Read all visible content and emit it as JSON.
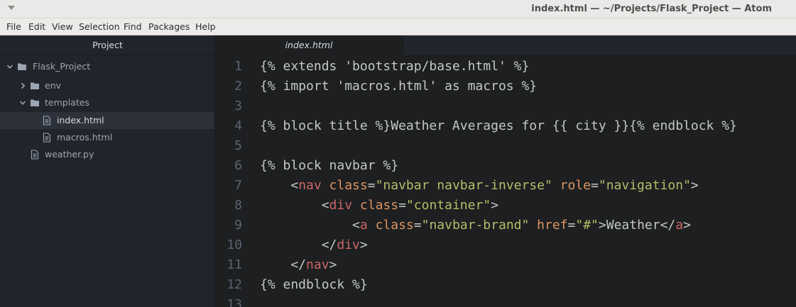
{
  "window": {
    "title": "index.html — ~/Projects/Flask_Project — Atom"
  },
  "menu": [
    "File",
    "Edit",
    "View",
    "Selection",
    "Find",
    "Packages",
    "Help"
  ],
  "tree_view": {
    "title": "Project",
    "items": [
      {
        "label": "Flask_Project",
        "kind": "folder",
        "expanded": true,
        "icon": "repo-icon"
      },
      {
        "label": "env",
        "kind": "folder",
        "expanded": false,
        "icon": "folder-icon"
      },
      {
        "label": "templates",
        "kind": "folder",
        "expanded": true,
        "icon": "folder-icon"
      },
      {
        "label": "index.html",
        "kind": "file",
        "selected": true,
        "icon": "file-icon"
      },
      {
        "label": "macros.html",
        "kind": "file",
        "icon": "file-icon"
      },
      {
        "label": "weather.py",
        "kind": "file",
        "icon": "file-icon"
      }
    ]
  },
  "tabs": [
    {
      "label": "index.html",
      "active": true
    }
  ],
  "editor": {
    "line_numbers": [
      "1",
      "2",
      "3",
      "4",
      "5",
      "6",
      "7",
      "8",
      "9",
      "10",
      "11",
      "12",
      "13"
    ],
    "lines": [
      [
        {
          "t": "{% extends 'bootstrap/base.html' %}",
          "c": "tpl"
        }
      ],
      [
        {
          "t": "{% import 'macros.html' as macros %}",
          "c": "tpl"
        }
      ],
      [],
      [
        {
          "t": "{% block title %}Weather Averages for {{ city }}{% endblock %}",
          "c": "tpl"
        }
      ],
      [],
      [
        {
          "t": "{% block navbar %}",
          "c": "tpl"
        }
      ],
      [
        {
          "t": "    <",
          "c": "txt"
        },
        {
          "t": "nav",
          "c": "tag"
        },
        {
          "t": " ",
          "c": "txt"
        },
        {
          "t": "class",
          "c": "attr"
        },
        {
          "t": "=",
          "c": "txt"
        },
        {
          "t": "\"navbar navbar-inverse\"",
          "c": "str"
        },
        {
          "t": " ",
          "c": "txt"
        },
        {
          "t": "role",
          "c": "attr"
        },
        {
          "t": "=",
          "c": "txt"
        },
        {
          "t": "\"navigation\"",
          "c": "str"
        },
        {
          "t": ">",
          "c": "txt"
        }
      ],
      [
        {
          "t": "        <",
          "c": "txt"
        },
        {
          "t": "div",
          "c": "tag"
        },
        {
          "t": " ",
          "c": "txt"
        },
        {
          "t": "class",
          "c": "attr"
        },
        {
          "t": "=",
          "c": "txt"
        },
        {
          "t": "\"container\"",
          "c": "str"
        },
        {
          "t": ">",
          "c": "txt"
        }
      ],
      [
        {
          "t": "            <",
          "c": "txt"
        },
        {
          "t": "a",
          "c": "tag"
        },
        {
          "t": " ",
          "c": "txt"
        },
        {
          "t": "class",
          "c": "attr"
        },
        {
          "t": "=",
          "c": "txt"
        },
        {
          "t": "\"navbar-brand\"",
          "c": "str"
        },
        {
          "t": " ",
          "c": "txt"
        },
        {
          "t": "href",
          "c": "attr"
        },
        {
          "t": "=",
          "c": "txt"
        },
        {
          "t": "\"#\"",
          "c": "str"
        },
        {
          "t": ">Weather</",
          "c": "txt"
        },
        {
          "t": "a",
          "c": "tag"
        },
        {
          "t": ">",
          "c": "txt"
        }
      ],
      [
        {
          "t": "        </",
          "c": "txt"
        },
        {
          "t": "div",
          "c": "tag"
        },
        {
          "t": ">",
          "c": "txt"
        }
      ],
      [
        {
          "t": "    </",
          "c": "txt"
        },
        {
          "t": "nav",
          "c": "tag"
        },
        {
          "t": ">",
          "c": "txt"
        }
      ],
      [
        {
          "t": "{% endblock %}",
          "c": "tpl"
        }
      ],
      []
    ]
  },
  "colors": {
    "editor_bg": "#1d1f21",
    "tag": "#cc6666",
    "attribute": "#de935f",
    "string": "#b5bd68",
    "text": "#c5c8c6",
    "line_number": "#5c6370"
  }
}
